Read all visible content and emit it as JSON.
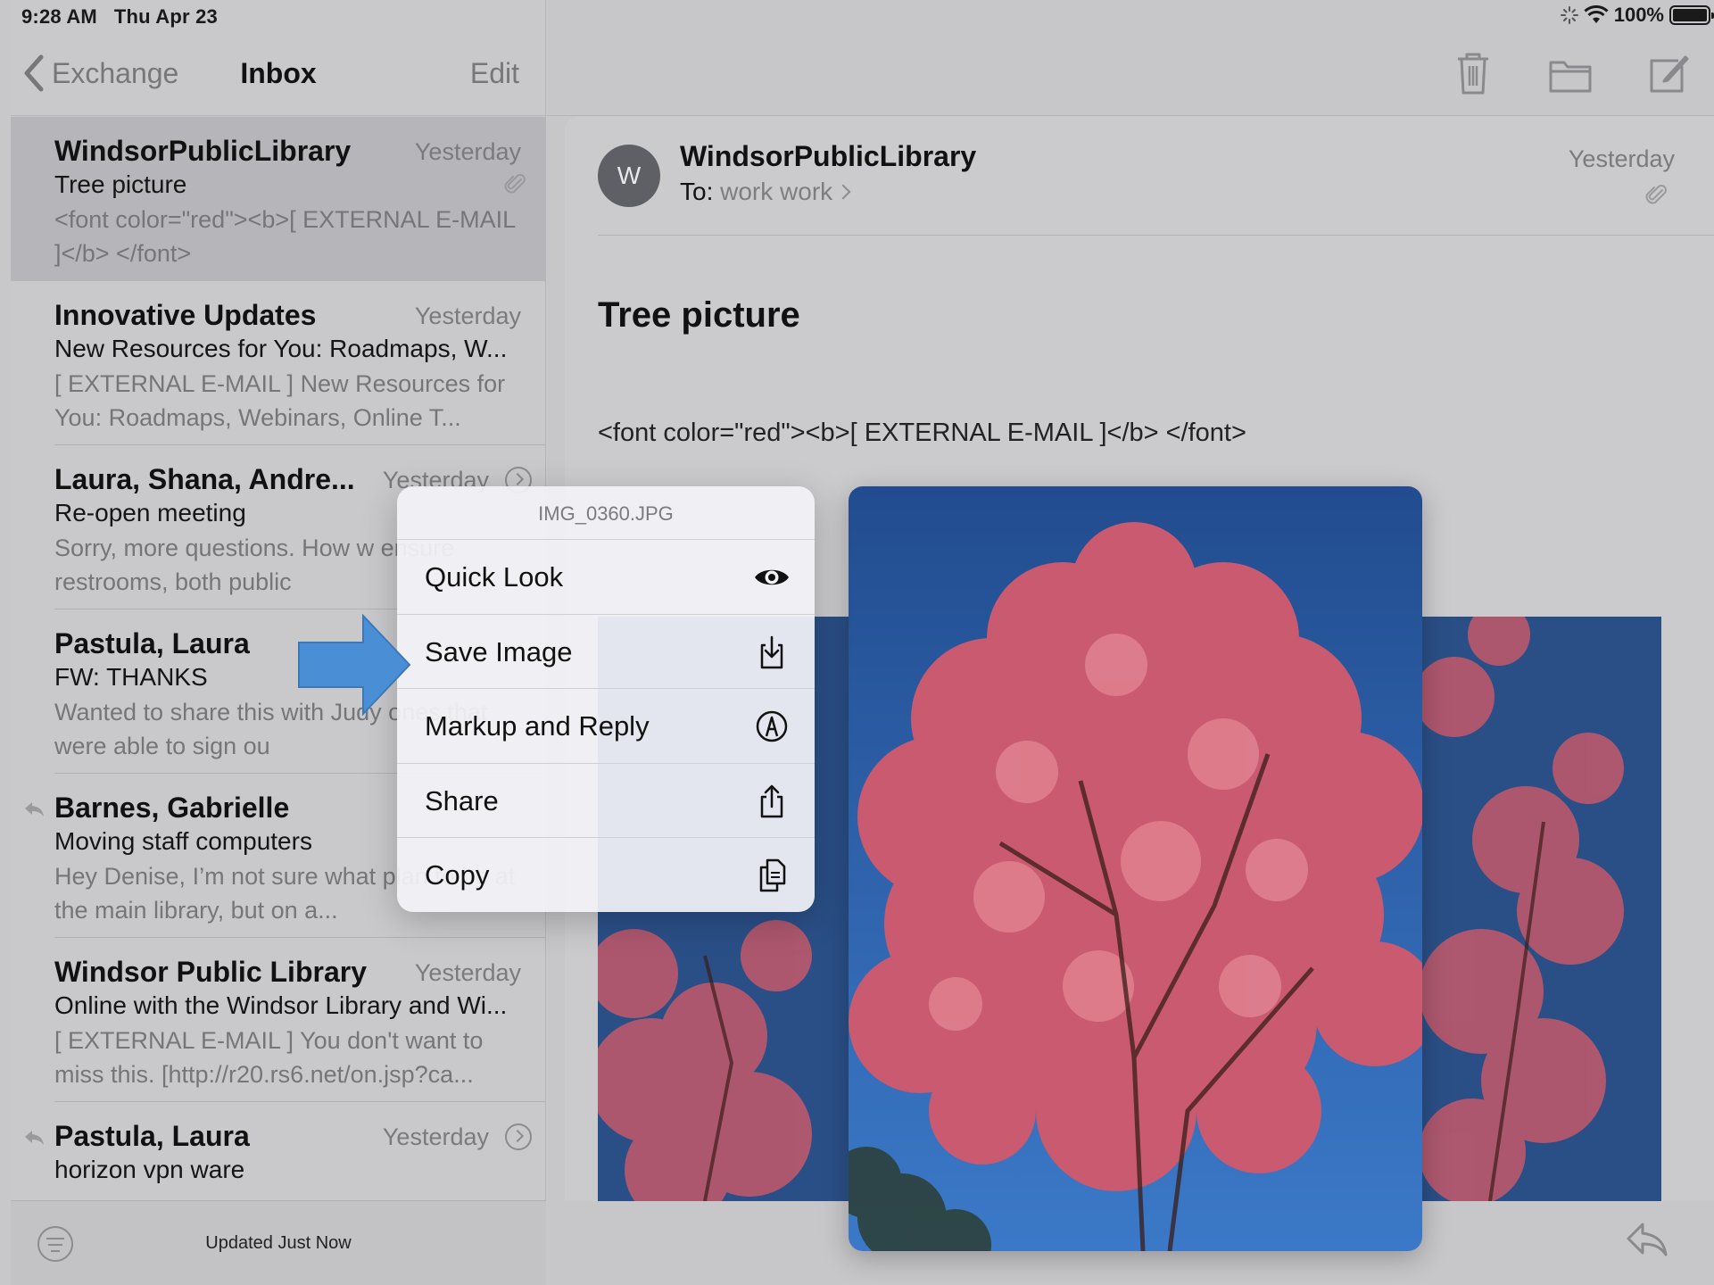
{
  "status_bar": {
    "time": "9:28 AM",
    "day": "Thu Apr 23",
    "battery": "100%"
  },
  "left_nav": {
    "back_label": "Exchange",
    "title": "Inbox",
    "edit_label": "Edit"
  },
  "messages": [
    {
      "from": "WindsorPublicLibrary",
      "date": "Yesterday",
      "subject": "Tree picture",
      "preview": "<font color=\"red\"><b>[ EXTERNAL E-MAIL ]</b> </font>",
      "selected": true,
      "attachment": true
    },
    {
      "from": "Innovative Updates",
      "date": "Yesterday",
      "subject": "New Resources for You: Roadmaps, W...",
      "preview": "[ EXTERNAL E-MAIL ] New Resources for You: Roadmaps, Webinars, Online T..."
    },
    {
      "from": "Laura, Shana, Andre...",
      "date": "Yesterday",
      "subject": "Re-open meeting",
      "preview": "Sorry, more questions. How w ensure restrooms, both public",
      "thread": true
    },
    {
      "from": "Pastula, Laura",
      "subject": "FW: THANKS",
      "preview": "Wanted to share this with Judy ones that were able to sign ou"
    },
    {
      "from": "Barnes, Gabrielle",
      "subject": "Moving staff computers",
      "preview": "Hey Denise, I’m not sure what plan to be at the main library, but on a...",
      "replied": true
    },
    {
      "from": "Windsor Public Library",
      "date": "Yesterday",
      "subject": "Online with the Windsor Library and Wi...",
      "preview": "[ EXTERNAL E-MAIL ] You don't want to miss this. [http://r20.rs6.net/on.jsp?ca..."
    },
    {
      "from": "Pastula, Laura",
      "date": "Yesterday",
      "subject": "horizon vpn ware",
      "preview": "",
      "replied": true,
      "thread": true
    }
  ],
  "bottom_bar": {
    "updated": "Updated Just Now"
  },
  "message_view": {
    "avatar_initial": "W",
    "sender": "WindsorPublicLibrary",
    "to_label": "To:",
    "to_address": "work work",
    "date": "Yesterday",
    "subject": "Tree picture",
    "body": "<font color=\"red\"><b>[ EXTERNAL E-MAIL ]</b> </font>"
  },
  "context_menu": {
    "title": "IMG_0360.JPG",
    "items": [
      {
        "label": "Quick Look",
        "icon": "eye-icon"
      },
      {
        "label": "Save Image",
        "icon": "save-image-icon"
      },
      {
        "label": "Markup and Reply",
        "icon": "markup-icon"
      },
      {
        "label": "Share",
        "icon": "share-icon"
      },
      {
        "label": "Copy",
        "icon": "copy-icon"
      }
    ]
  },
  "colors": {
    "annotation_arrow": "#4a8fd6",
    "sky": "#2f5fa8",
    "blossom": "#d45a6e"
  }
}
